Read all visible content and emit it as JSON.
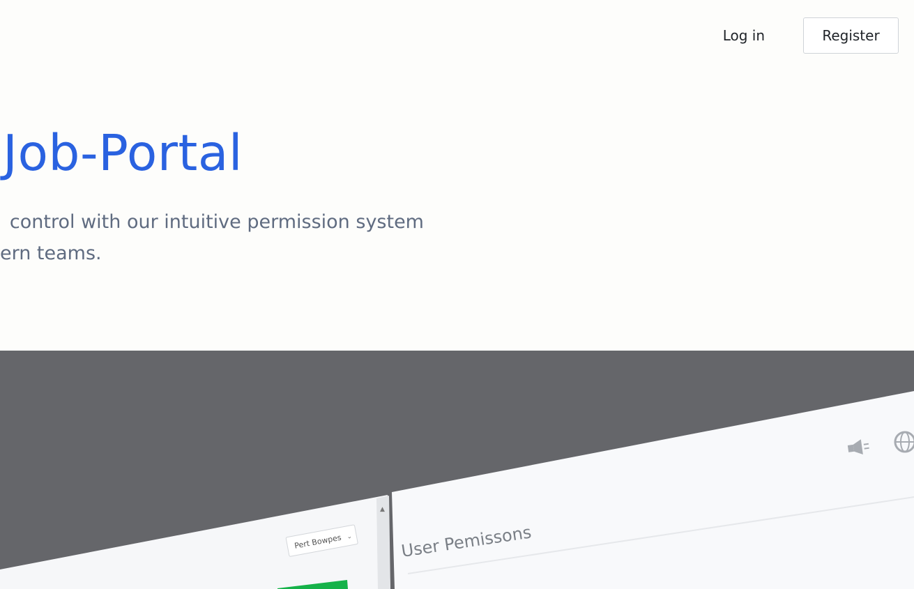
{
  "header": {
    "login_label": "Log in",
    "register_label": "Register"
  },
  "hero": {
    "title": "Job-Portal",
    "subtitle_line1": "control with our intuitive permission system",
    "subtitle_line2": "ern teams."
  },
  "preview": {
    "dropdown_label": "Pert Bowpes",
    "panel_title": "User Pemissons",
    "icons": [
      "megaphone-icon",
      "globe-icon"
    ]
  },
  "colors": {
    "accent": "#2a62e0",
    "subtitle": "#5f6b80",
    "band": "#65666a",
    "green": "#16b24a"
  }
}
